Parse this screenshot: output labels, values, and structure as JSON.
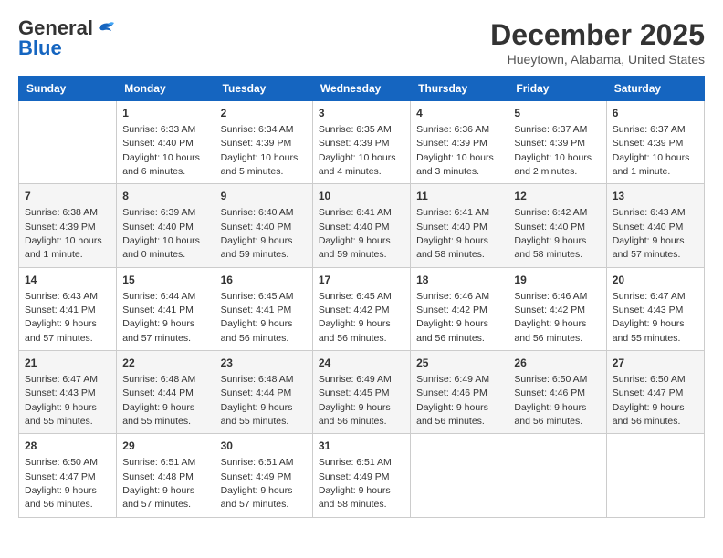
{
  "header": {
    "logo_general": "General",
    "logo_blue": "Blue",
    "month_title": "December 2025",
    "location": "Hueytown, Alabama, United States"
  },
  "days_of_week": [
    "Sunday",
    "Monday",
    "Tuesday",
    "Wednesday",
    "Thursday",
    "Friday",
    "Saturday"
  ],
  "weeks": [
    [
      {
        "day": "",
        "info": ""
      },
      {
        "day": "1",
        "info": "Sunrise: 6:33 AM\nSunset: 4:40 PM\nDaylight: 10 hours\nand 6 minutes."
      },
      {
        "day": "2",
        "info": "Sunrise: 6:34 AM\nSunset: 4:39 PM\nDaylight: 10 hours\nand 5 minutes."
      },
      {
        "day": "3",
        "info": "Sunrise: 6:35 AM\nSunset: 4:39 PM\nDaylight: 10 hours\nand 4 minutes."
      },
      {
        "day": "4",
        "info": "Sunrise: 6:36 AM\nSunset: 4:39 PM\nDaylight: 10 hours\nand 3 minutes."
      },
      {
        "day": "5",
        "info": "Sunrise: 6:37 AM\nSunset: 4:39 PM\nDaylight: 10 hours\nand 2 minutes."
      },
      {
        "day": "6",
        "info": "Sunrise: 6:37 AM\nSunset: 4:39 PM\nDaylight: 10 hours\nand 1 minute."
      }
    ],
    [
      {
        "day": "7",
        "info": "Sunrise: 6:38 AM\nSunset: 4:39 PM\nDaylight: 10 hours\nand 1 minute."
      },
      {
        "day": "8",
        "info": "Sunrise: 6:39 AM\nSunset: 4:40 PM\nDaylight: 10 hours\nand 0 minutes."
      },
      {
        "day": "9",
        "info": "Sunrise: 6:40 AM\nSunset: 4:40 PM\nDaylight: 9 hours\nand 59 minutes."
      },
      {
        "day": "10",
        "info": "Sunrise: 6:41 AM\nSunset: 4:40 PM\nDaylight: 9 hours\nand 59 minutes."
      },
      {
        "day": "11",
        "info": "Sunrise: 6:41 AM\nSunset: 4:40 PM\nDaylight: 9 hours\nand 58 minutes."
      },
      {
        "day": "12",
        "info": "Sunrise: 6:42 AM\nSunset: 4:40 PM\nDaylight: 9 hours\nand 58 minutes."
      },
      {
        "day": "13",
        "info": "Sunrise: 6:43 AM\nSunset: 4:40 PM\nDaylight: 9 hours\nand 57 minutes."
      }
    ],
    [
      {
        "day": "14",
        "info": "Sunrise: 6:43 AM\nSunset: 4:41 PM\nDaylight: 9 hours\nand 57 minutes."
      },
      {
        "day": "15",
        "info": "Sunrise: 6:44 AM\nSunset: 4:41 PM\nDaylight: 9 hours\nand 57 minutes."
      },
      {
        "day": "16",
        "info": "Sunrise: 6:45 AM\nSunset: 4:41 PM\nDaylight: 9 hours\nand 56 minutes."
      },
      {
        "day": "17",
        "info": "Sunrise: 6:45 AM\nSunset: 4:42 PM\nDaylight: 9 hours\nand 56 minutes."
      },
      {
        "day": "18",
        "info": "Sunrise: 6:46 AM\nSunset: 4:42 PM\nDaylight: 9 hours\nand 56 minutes."
      },
      {
        "day": "19",
        "info": "Sunrise: 6:46 AM\nSunset: 4:42 PM\nDaylight: 9 hours\nand 56 minutes."
      },
      {
        "day": "20",
        "info": "Sunrise: 6:47 AM\nSunset: 4:43 PM\nDaylight: 9 hours\nand 55 minutes."
      }
    ],
    [
      {
        "day": "21",
        "info": "Sunrise: 6:47 AM\nSunset: 4:43 PM\nDaylight: 9 hours\nand 55 minutes."
      },
      {
        "day": "22",
        "info": "Sunrise: 6:48 AM\nSunset: 4:44 PM\nDaylight: 9 hours\nand 55 minutes."
      },
      {
        "day": "23",
        "info": "Sunrise: 6:48 AM\nSunset: 4:44 PM\nDaylight: 9 hours\nand 55 minutes."
      },
      {
        "day": "24",
        "info": "Sunrise: 6:49 AM\nSunset: 4:45 PM\nDaylight: 9 hours\nand 56 minutes."
      },
      {
        "day": "25",
        "info": "Sunrise: 6:49 AM\nSunset: 4:46 PM\nDaylight: 9 hours\nand 56 minutes."
      },
      {
        "day": "26",
        "info": "Sunrise: 6:50 AM\nSunset: 4:46 PM\nDaylight: 9 hours\nand 56 minutes."
      },
      {
        "day": "27",
        "info": "Sunrise: 6:50 AM\nSunset: 4:47 PM\nDaylight: 9 hours\nand 56 minutes."
      }
    ],
    [
      {
        "day": "28",
        "info": "Sunrise: 6:50 AM\nSunset: 4:47 PM\nDaylight: 9 hours\nand 56 minutes."
      },
      {
        "day": "29",
        "info": "Sunrise: 6:51 AM\nSunset: 4:48 PM\nDaylight: 9 hours\nand 57 minutes."
      },
      {
        "day": "30",
        "info": "Sunrise: 6:51 AM\nSunset: 4:49 PM\nDaylight: 9 hours\nand 57 minutes."
      },
      {
        "day": "31",
        "info": "Sunrise: 6:51 AM\nSunset: 4:49 PM\nDaylight: 9 hours\nand 58 minutes."
      },
      {
        "day": "",
        "info": ""
      },
      {
        "day": "",
        "info": ""
      },
      {
        "day": "",
        "info": ""
      }
    ]
  ]
}
